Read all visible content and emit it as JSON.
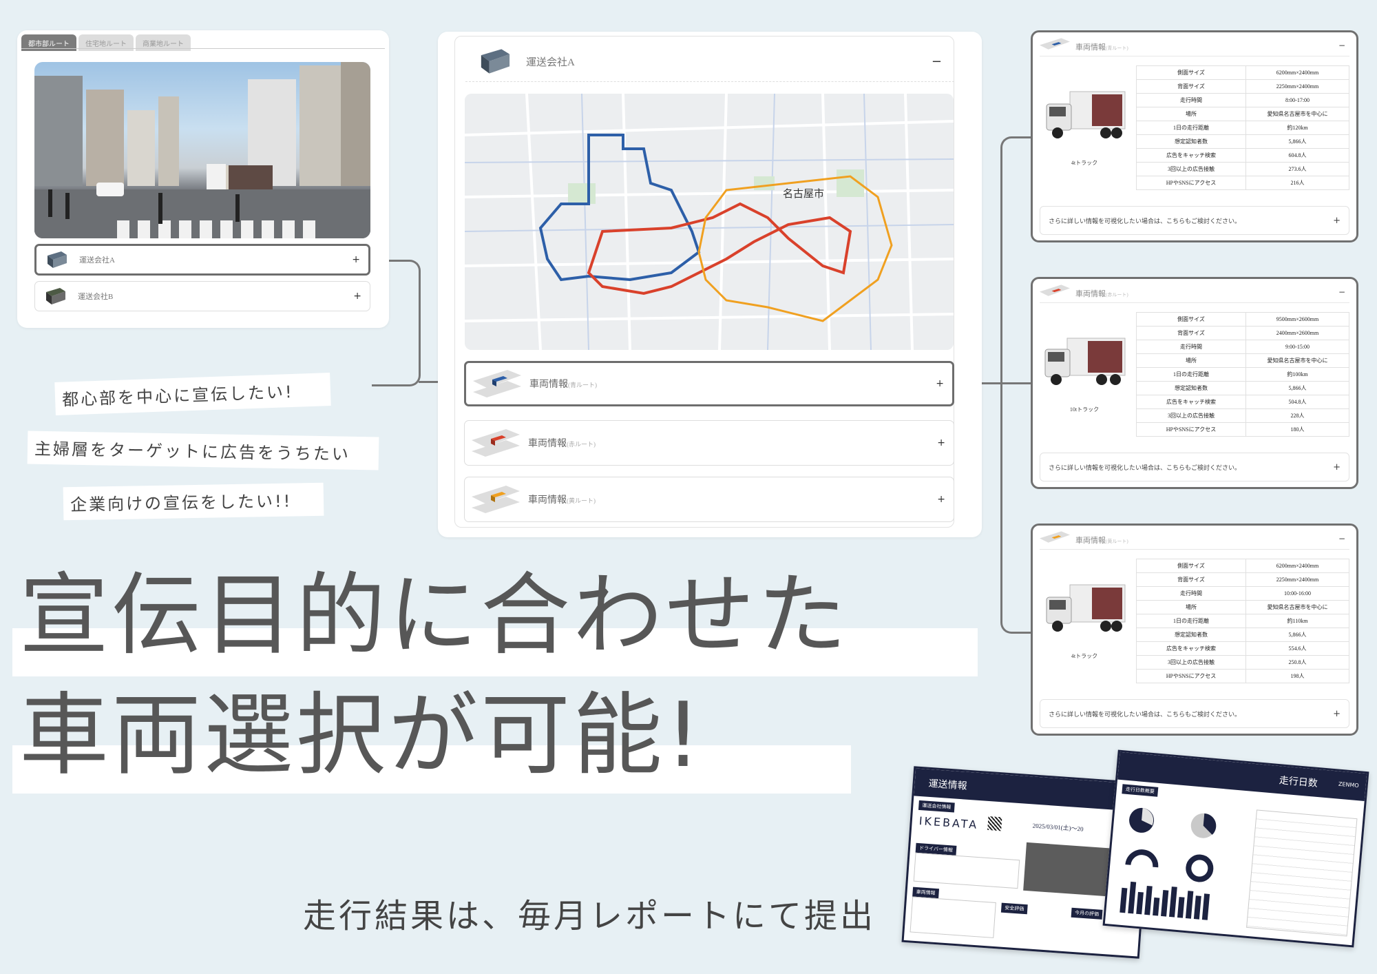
{
  "left_panel": {
    "tabs": [
      "都市部ルート",
      "住宅地ルート",
      "商業地ルート"
    ],
    "companies": [
      {
        "label": "運送会社A",
        "toggle": "+"
      },
      {
        "label": "運送会社B",
        "toggle": "+"
      }
    ]
  },
  "center_panel": {
    "company": "運送会社A",
    "collapse": "−",
    "map_label": "名古屋市",
    "vehicle_rows": [
      {
        "label": "車両情報",
        "route": "(青ルート)",
        "toggle": "+",
        "color": "#2d5fa8"
      },
      {
        "label": "車両情報",
        "route": "(赤ルート)",
        "toggle": "+",
        "color": "#d9412b"
      },
      {
        "label": "車両情報",
        "route": "(黄ルート)",
        "toggle": "+",
        "color": "#f0a020"
      }
    ]
  },
  "spec_labels": [
    "側面サイズ",
    "背面サイズ",
    "走行時間",
    "場所",
    "1日の走行距離",
    "想定認知者数",
    "広告をキャッチ検索",
    "3回以上の広告接触",
    "HPやSNSにアクセス"
  ],
  "vehicle_cards": [
    {
      "title": "車両情報",
      "route": "(青ルート)",
      "minus": "−",
      "truck": "4tトラック",
      "values": [
        "6200mm×2400mm",
        "2250mm×2400mm",
        "8:00-17:00",
        "愛知県名古屋市を中心に",
        "約120km",
        "5,866人",
        "604.8人",
        "273.6人",
        "216人"
      ],
      "more": "さらに詳しい情報を可視化したい場合は、こちらもご検討ください。",
      "plus": "+"
    },
    {
      "title": "車両情報",
      "route": "(赤ルート)",
      "minus": "−",
      "truck": "10tトラック",
      "values": [
        "9500mm×2600mm",
        "2400mm×2600mm",
        "9:00-15:00",
        "愛知県名古屋市を中心に",
        "約100km",
        "5,866人",
        "504.8人",
        "228人",
        "180人"
      ],
      "more": "さらに詳しい情報を可視化したい場合は、こちらもご検討ください。",
      "plus": "+"
    },
    {
      "title": "車両情報",
      "route": "(黄ルート)",
      "minus": "−",
      "truck": "4tトラック",
      "values": [
        "6200mm×2400mm",
        "2250mm×2400mm",
        "10:00-16:00",
        "愛知県名古屋市を中心に",
        "約110km",
        "5,866人",
        "554.6人",
        "250.8人",
        "198人"
      ],
      "more": "さらに詳しい情報を可視化したい場合は、こちらもご検討ください。",
      "plus": "+"
    }
  ],
  "notes": [
    "都心部を中心に宣伝したい!",
    "主婦層をターゲットに広告をうちたい",
    "企業向けの宣伝をしたい!!"
  ],
  "headline": {
    "line1": "宣伝目的に合わせた",
    "line2": "車両選択が可能!"
  },
  "footer": "走行結果は、毎月レポートにて提出",
  "report_a": {
    "header": "運送情報",
    "brand": "IKEBATA",
    "tag": "運送会社情報",
    "date": "2025/03/01(土)〜20",
    "section1": "ドライバー情報",
    "section2": "車両情報",
    "section3": "安全評価",
    "section4": "今月の評価"
  },
  "report_b": {
    "header": "走行日数",
    "tag": "走行日数概要",
    "logo": "ZENMO"
  }
}
